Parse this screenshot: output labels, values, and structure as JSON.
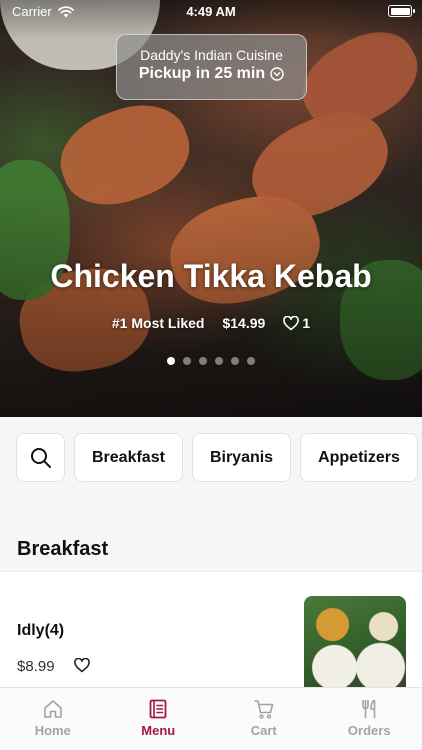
{
  "status_bar": {
    "carrier": "Carrier",
    "time": "4:49 AM"
  },
  "pickup": {
    "restaurant": "Daddy's Indian Cuisine",
    "eta": "Pickup in 25 min"
  },
  "featured": {
    "title": "Chicken Tikka Kebab",
    "badge": "#1 Most Liked",
    "price": "$14.99",
    "likes": "1",
    "slide_count": 6,
    "active_slide": 0
  },
  "categories": {
    "search_icon": "search-icon",
    "items": [
      "Breakfast",
      "Biryanis",
      "Appetizers"
    ]
  },
  "section": {
    "title": "Breakfast"
  },
  "menu_items": [
    {
      "name": "Idly(4)",
      "price": "$8.99",
      "favorite_icon": "heart-outline-icon"
    }
  ],
  "tab_bar": {
    "tabs": [
      {
        "label": "Home",
        "icon": "home-icon"
      },
      {
        "label": "Menu",
        "icon": "menu-book-icon"
      },
      {
        "label": "Cart",
        "icon": "cart-icon"
      },
      {
        "label": "Orders",
        "icon": "fork-knife-icon"
      }
    ],
    "active": "Menu"
  },
  "colors": {
    "accent": "#a3164e",
    "inactive_tab": "#a3a3a3"
  }
}
